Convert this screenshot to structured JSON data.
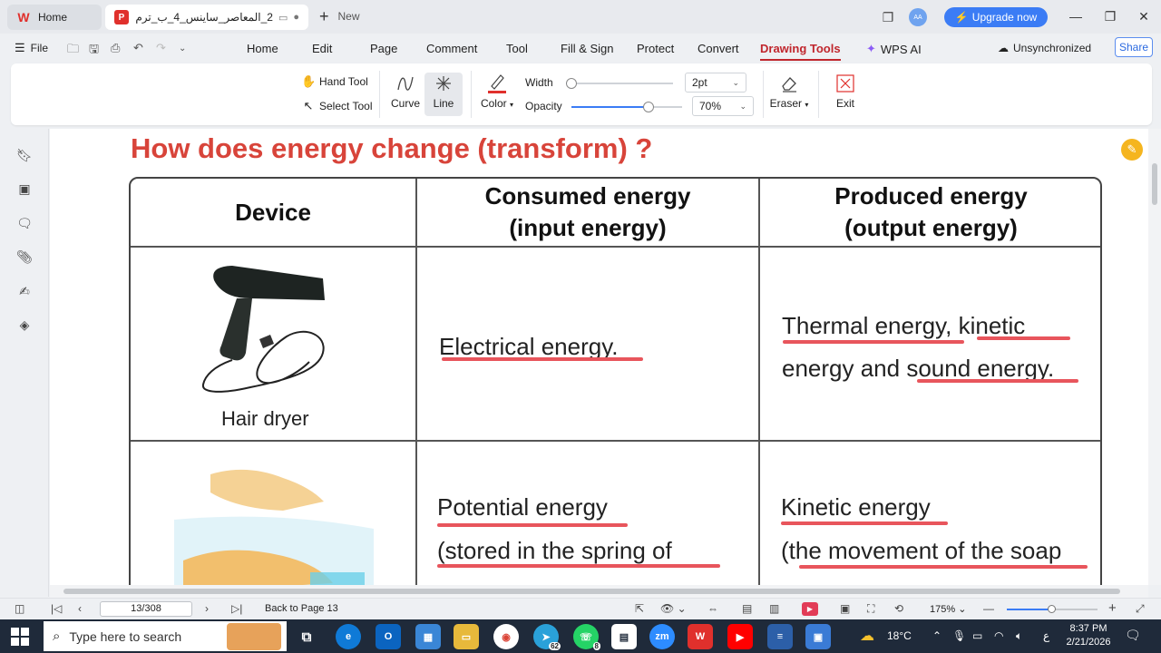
{
  "titlebar": {
    "home_tab": "Home",
    "doc_tab": "2_المعاصر_ساينس_4_ب_ترم_...ل",
    "new_tab": "New",
    "upgrade": "Upgrade now",
    "avatar_initials": "AA"
  },
  "menubar": {
    "file": "File",
    "items": [
      "Home",
      "Edit",
      "Page",
      "Comment",
      "Tool",
      "Fill & Sign",
      "Protect",
      "Convert",
      "Drawing Tools"
    ],
    "active": "Drawing Tools",
    "wps_ai": "WPS AI",
    "unsync": "Unsynchronized",
    "share": "Share"
  },
  "ribbon": {
    "hand_tool": "Hand Tool",
    "select_tool": "Select Tool",
    "curve": "Curve",
    "line": "Line",
    "color": "Color",
    "width_label": "Width",
    "opacity_label": "Opacity",
    "width_value": "2pt",
    "opacity_value": "70%",
    "eraser": "Eraser",
    "exit": "Exit",
    "width_slider_fraction": 0.05,
    "opacity_slider_fraction": 0.7,
    "pen_color": "#e0302c"
  },
  "document": {
    "title": "How does energy change (transform) ?",
    "headers": {
      "device": "Device",
      "consumed_1": "Consumed energy",
      "consumed_2": "(input energy)",
      "produced_1": "Produced energy",
      "produced_2": "(output energy)"
    },
    "row1": {
      "device_caption": "Hair dryer",
      "input": "Electrical energy.",
      "output_line1": "Thermal energy, kinetic",
      "output_line2": "energy and sound energy."
    },
    "row2": {
      "input_line1": "Potential energy",
      "input_line2": "(stored in the spring of",
      "output_line1": "Kinetic energy",
      "output_line2": "(the movement of the soap"
    },
    "title_color": "#d8443a",
    "underline_color": "#e8555c"
  },
  "statusbar": {
    "page": "13/308",
    "back_to": "Back to Page 13",
    "zoom": "175%"
  },
  "taskbar": {
    "search_placeholder": "Type here to search",
    "weather": "18°C",
    "time": "8:37 PM",
    "date": "2/21/2026",
    "lang": "ع",
    "telegram_badge": "62",
    "whatsapp_badge": "8"
  }
}
